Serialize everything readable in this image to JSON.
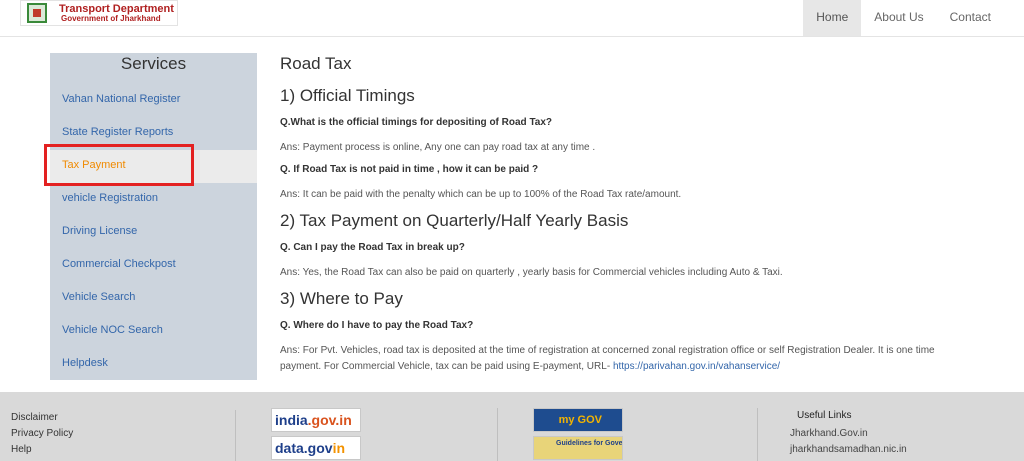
{
  "header": {
    "logo_title": "Transport Department",
    "logo_subtitle": "Government of Jharkhand",
    "nav": [
      {
        "label": "Home",
        "active": true
      },
      {
        "label": "About Us",
        "active": false
      },
      {
        "label": "Contact",
        "active": false
      }
    ]
  },
  "sidebar": {
    "title": "Services",
    "items": [
      {
        "label": "Vahan National Register"
      },
      {
        "label": "State Register Reports"
      },
      {
        "label": "Tax Payment",
        "active": true
      },
      {
        "label": "vehicle Registration"
      },
      {
        "label": "Driving License"
      },
      {
        "label": "Commercial Checkpost"
      },
      {
        "label": "Vehicle Search"
      },
      {
        "label": "Vehicle NOC Search"
      },
      {
        "label": "Helpdesk"
      }
    ]
  },
  "main": {
    "title": "Road Tax",
    "sections": [
      {
        "heading": "1) Official Timings",
        "q1": "Q.What is the official timings for depositing of Road Tax?",
        "a1": "Ans: Payment process is online, Any one can pay road tax at any time .",
        "q2": "Q. If Road Tax is not paid in time , how it can be paid ?",
        "a2": "Ans: It can be paid with the penalty which can be up to 100% of the Road Tax rate/amount."
      },
      {
        "heading": "2) Tax Payment on Quarterly/Half Yearly Basis",
        "q1": "Q. Can I pay the Road Tax in break up?",
        "a1": "Ans: Yes, the Road Tax can also be paid on quarterly , yearly basis for Commercial vehicles including Auto & Taxi."
      },
      {
        "heading": "3) Where to Pay",
        "q1": "Q. Where do I have to pay the Road Tax?",
        "a1": "Ans: For Pvt. Vehicles, road tax is deposited at the time of registration at concerned zonal registration office or self Registration Dealer. It is one time payment. For Commercial Vehicle, tax can be paid using E-payment, URL- ",
        "a1_link": "https://parivahan.gov.in/vahanservice/"
      }
    ]
  },
  "footer": {
    "links": [
      "Disclaimer",
      "Privacy Policy",
      "Help"
    ],
    "badges": {
      "india_a": "india",
      "india_b": ".gov.in",
      "data_a": "data.gov",
      "data_b": "in",
      "mygov": "my GOV",
      "guidelines": "Guidelines for Government Websites"
    },
    "useful_heading": "Useful Links",
    "useful_links": [
      "Jharkhand.Gov.in",
      "jharkhandsamadhan.nic.in"
    ]
  }
}
